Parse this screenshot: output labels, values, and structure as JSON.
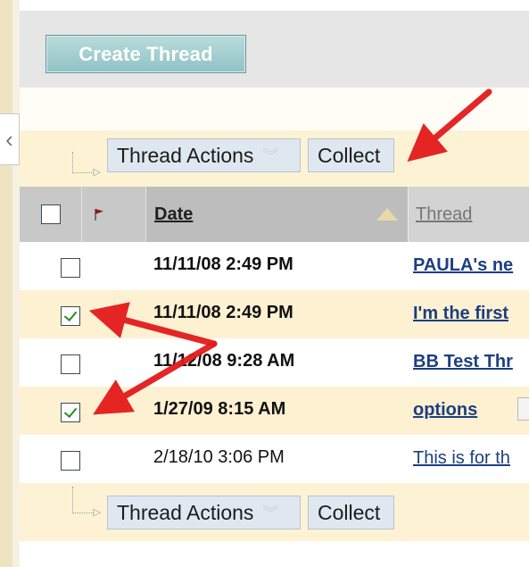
{
  "toolbar": {
    "create_thread_label": "Create Thread"
  },
  "thread_actions": {
    "actions_label": "Thread Actions",
    "collect_label": "Collect"
  },
  "columns": {
    "date": "Date",
    "thread": "Thread"
  },
  "rows": [
    {
      "date": "11/11/08 2:49 PM",
      "thread": "PAULA's ne",
      "checked": false,
      "bold": true
    },
    {
      "date": "11/11/08 2:49 PM",
      "thread": "I'm the first",
      "checked": true,
      "bold": true
    },
    {
      "date": "11/12/08 9:28 AM",
      "thread": "BB Test Thr",
      "checked": false,
      "bold": true
    },
    {
      "date": "1/27/09 8:15 AM",
      "thread": "options",
      "checked": true,
      "bold": true
    },
    {
      "date": "2/18/10 3:06 PM",
      "thread": "This is for th",
      "checked": false,
      "bold": false
    }
  ],
  "icons": {
    "collapse": "chevron-left-icon",
    "flag": "flag-icon",
    "sort": "sort-ascending-icon",
    "dropdown": "chevron-double-down-icon",
    "annotation": "red-arrow-icon"
  },
  "colors": {
    "accent_teal": "#8fc2c4",
    "selected_row": "#fdf1d2",
    "link": "#1d3f80",
    "annotation_red": "#e31b1b"
  }
}
